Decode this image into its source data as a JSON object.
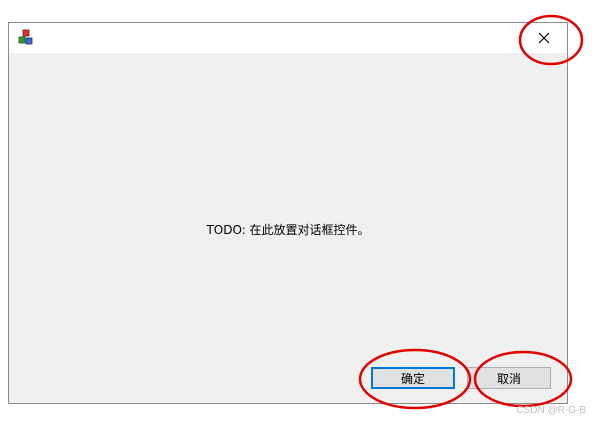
{
  "dialog": {
    "message": "TODO: 在此放置对话框控件。",
    "ok_label": "确定",
    "cancel_label": "取消",
    "close_icon": "close-icon",
    "app_icon": "app-icon"
  },
  "annotations": {
    "color": "#e00000",
    "shape": "ellipse"
  },
  "watermark": "CSDN @R-G-B",
  "colors": {
    "accent": "#0078d7",
    "dialog_bg": "#f0f0f0"
  }
}
